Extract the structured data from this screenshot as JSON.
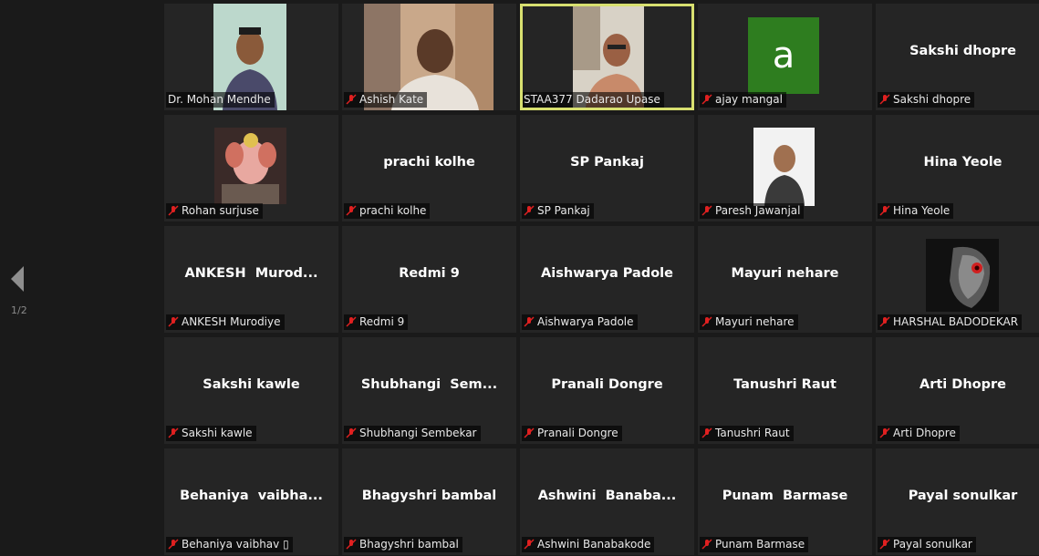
{
  "pagination": {
    "current_page": "1/2"
  },
  "participants": [
    {
      "display_name": "",
      "label": "Dr. Mohan Mendhe",
      "muted": false,
      "video": "person-mint"
    },
    {
      "display_name": "",
      "label": "Ashish Kate",
      "muted": true,
      "video": "person-room"
    },
    {
      "display_name": "",
      "label": "STAA377 Dadarao Upase",
      "muted": false,
      "video": "person-glasses",
      "active_speaker": true
    },
    {
      "display_name": "",
      "label": "ajay mangal",
      "muted": true,
      "avatar_letter": "a",
      "avatar_color": "#2e7d1f"
    },
    {
      "display_name": "Sakshi dhopre",
      "label": "Sakshi dhopre",
      "muted": true
    },
    {
      "display_name": "",
      "label": "Rohan surjuse",
      "muted": true,
      "video": "ganesha-image"
    },
    {
      "display_name": "prachi kolhe",
      "label": "prachi kolhe",
      "muted": true
    },
    {
      "display_name": "SP Pankaj",
      "label": "SP Pankaj",
      "muted": true
    },
    {
      "display_name": "",
      "label": "Paresh Jawanjal",
      "muted": true,
      "video": "person-portrait"
    },
    {
      "display_name": "Hina Yeole",
      "label": "Hina Yeole",
      "muted": true
    },
    {
      "display_name": "ANKESH  Murod...",
      "label": "ANKESH Murodiye",
      "muted": true
    },
    {
      "display_name": "Redmi 9",
      "label": "Redmi 9",
      "muted": true
    },
    {
      "display_name": "Aishwarya Padole",
      "label": "Aishwarya Padole",
      "muted": true
    },
    {
      "display_name": "Mayuri nehare",
      "label": "Mayuri nehare",
      "muted": true
    },
    {
      "display_name": "",
      "label": "HARSHAL BADODEKAR",
      "muted": true,
      "video": "dark-mask-image"
    },
    {
      "display_name": "Sakshi kawle",
      "label": "Sakshi kawle",
      "muted": true
    },
    {
      "display_name": "Shubhangi  Sem...",
      "label": "Shubhangi Sembekar",
      "muted": true
    },
    {
      "display_name": "Pranali Dongre",
      "label": "Pranali Dongre",
      "muted": true
    },
    {
      "display_name": "Tanushri Raut",
      "label": "Tanushri Raut",
      "muted": true
    },
    {
      "display_name": "Arti Dhopre",
      "label": "Arti Dhopre",
      "muted": true
    },
    {
      "display_name": "Behaniya  vaibha...",
      "label": "Behaniya vaibhav ▯",
      "muted": true
    },
    {
      "display_name": "Bhagyshri bambal",
      "label": "Bhagyshri bambal",
      "muted": true
    },
    {
      "display_name": "Ashwini  Banaba...",
      "label": "Ashwini Banabakode",
      "muted": true
    },
    {
      "display_name": "Punam  Barmase",
      "label": "Punam  Barmase",
      "muted": true
    },
    {
      "display_name": "Payal sonulkar",
      "label": "Payal sonulkar",
      "muted": true
    }
  ],
  "colors": {
    "background": "#1a1a1a",
    "tile": "#252525",
    "active_border": "#d8e070",
    "muted_icon": "#e02020"
  }
}
